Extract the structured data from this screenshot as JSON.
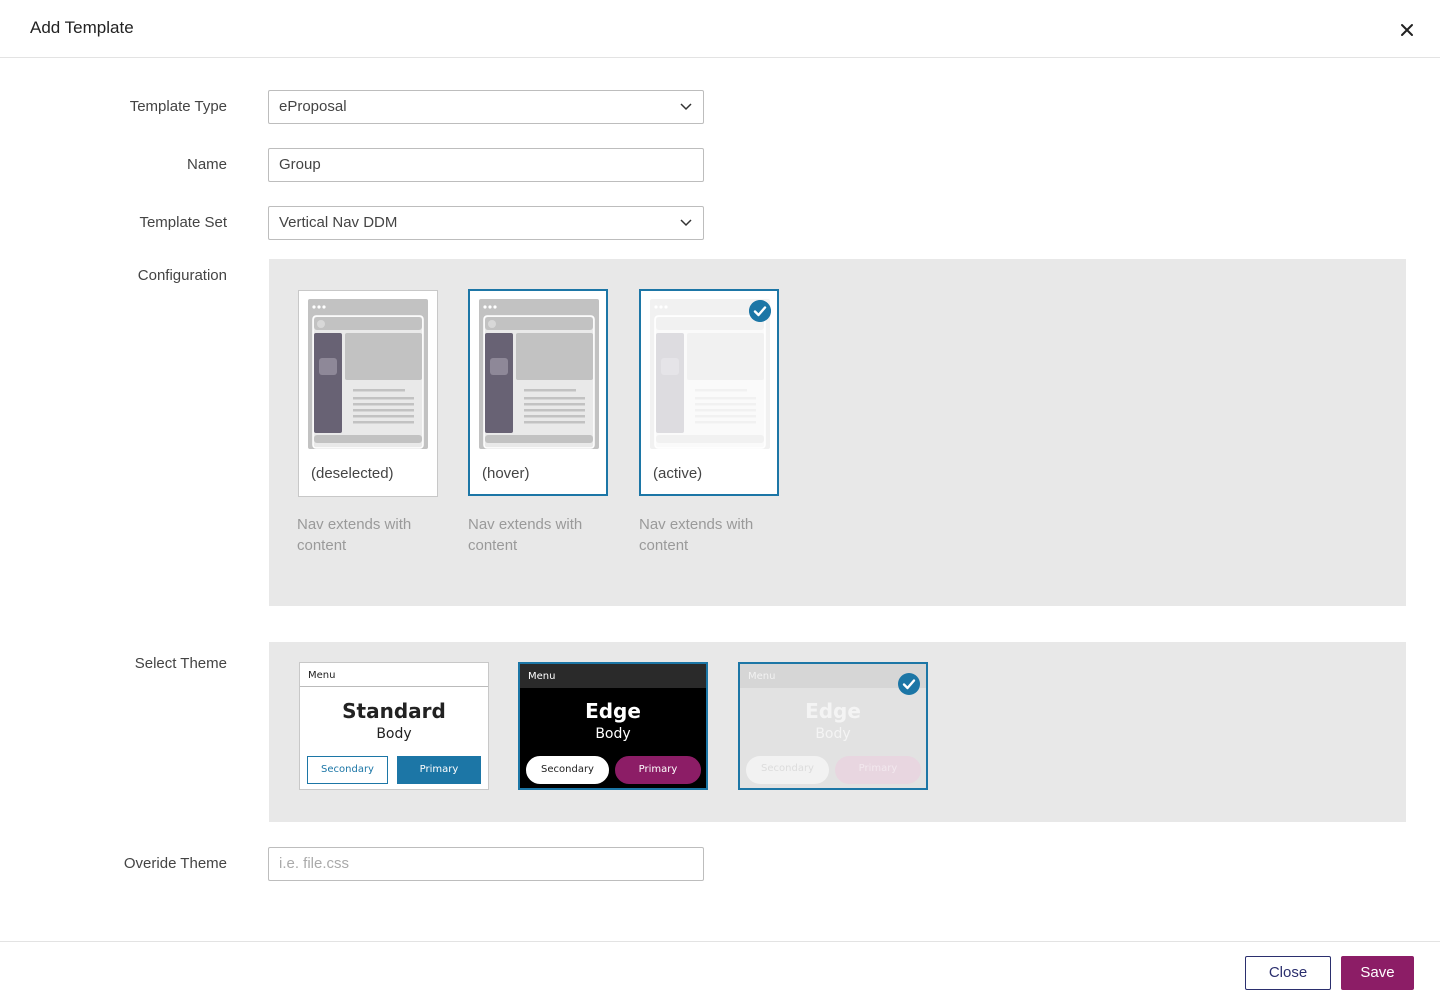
{
  "header": {
    "title": "Add Template"
  },
  "form": {
    "template_type": {
      "label": "Template Type",
      "value": "eProposal"
    },
    "name": {
      "label": "Name",
      "value": "Group"
    },
    "template_set": {
      "label": "Template Set",
      "value": "Vertical Nav DDM"
    },
    "configuration": {
      "label": "Configuration",
      "cards": [
        {
          "caption": "(deselected)",
          "description": "Nav extends with content",
          "state": "deselected"
        },
        {
          "caption": "(hover)",
          "description": "Nav extends with content",
          "state": "hover"
        },
        {
          "caption": "(active)",
          "description": "Nav extends with content",
          "state": "active"
        }
      ]
    },
    "select_theme": {
      "label": "Select Theme",
      "themes": [
        {
          "menu": "Menu",
          "title": "Standard",
          "body": "Body",
          "secondary": "Secondary",
          "primary": "Primary"
        },
        {
          "menu": "Menu",
          "title": "Edge",
          "body": "Body",
          "secondary": "Secondary",
          "primary": "Primary"
        },
        {
          "menu": "Menu",
          "title": "Edge",
          "body": "Body",
          "secondary": "Secondary",
          "primary": "Primary"
        }
      ]
    },
    "override_theme": {
      "label": "Overide Theme",
      "placeholder": "i.e. file.css",
      "value": ""
    }
  },
  "footer": {
    "close_label": "Close",
    "save_label": "Save"
  },
  "colors": {
    "accent": "#1c76a6",
    "brand": "#8c1d66",
    "navy": "#2b2f6e",
    "panel": "#e8e8e8"
  },
  "icons": {
    "close": "close-icon",
    "chevron": "chevron-down-icon",
    "check": "check-circle-icon"
  }
}
